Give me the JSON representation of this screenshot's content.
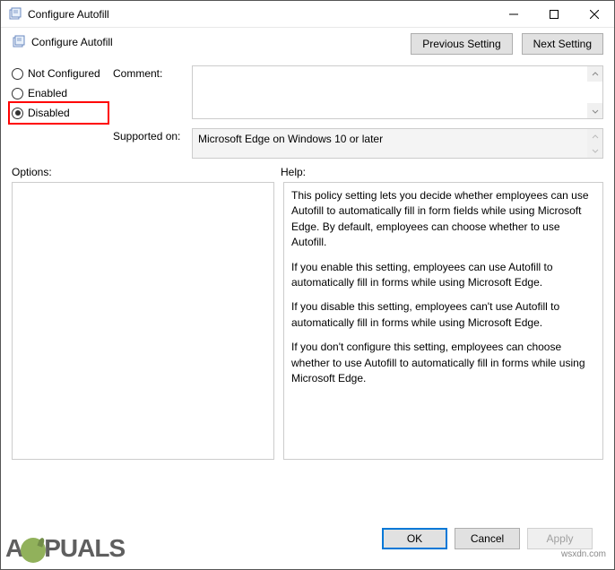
{
  "window": {
    "title": "Configure Autofill"
  },
  "header": {
    "title": "Configure Autofill"
  },
  "nav": {
    "previous": "Previous Setting",
    "next": "Next Setting"
  },
  "radios": {
    "not_configured": "Not Configured",
    "enabled": "Enabled",
    "disabled": "Disabled",
    "selected": "disabled"
  },
  "fields": {
    "comment_label": "Comment:",
    "comment_value": "",
    "supported_label": "Supported on:",
    "supported_value": "Microsoft Edge on Windows 10 or later"
  },
  "sections": {
    "options_label": "Options:",
    "help_label": "Help:"
  },
  "help_text": {
    "p1": "This policy setting lets you decide whether employees can use Autofill to automatically fill in form fields while using Microsoft Edge. By default, employees can choose whether to use Autofill.",
    "p2": "If you enable this setting, employees can use Autofill to automatically fill in forms while using Microsoft Edge.",
    "p3": "If you disable this setting, employees can't use Autofill to automatically fill in forms while using Microsoft Edge.",
    "p4": "If you don't configure this setting, employees can choose whether to use Autofill to automatically fill in forms while using Microsoft Edge."
  },
  "footer": {
    "ok": "OK",
    "cancel": "Cancel",
    "apply": "Apply"
  },
  "watermark": {
    "left_pre": "A",
    "left_post": "PUALS",
    "right": "wsxdn.com"
  }
}
